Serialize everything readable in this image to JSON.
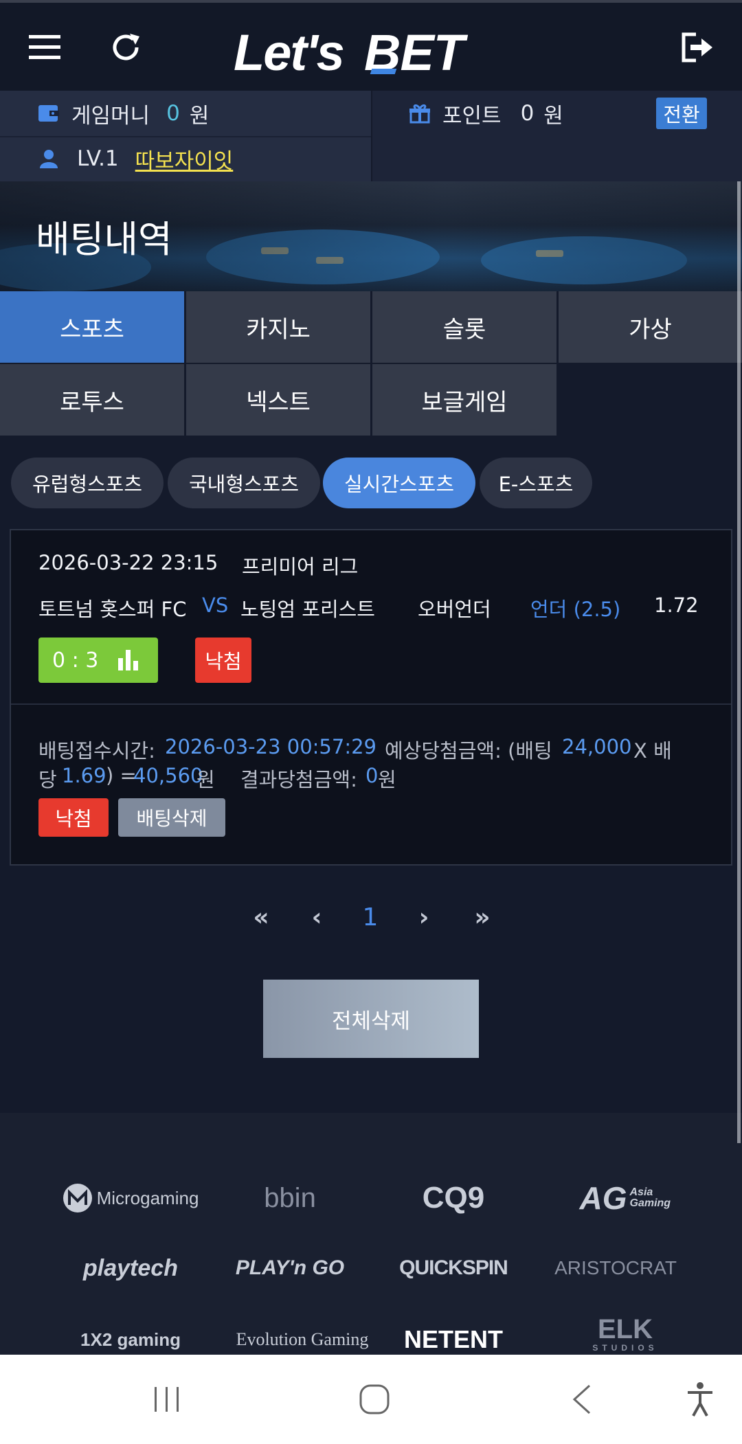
{
  "header": {
    "logo_part1": "Let's",
    "logo_part2": "BET",
    "menu_icon": "menu-icon",
    "refresh_icon": "refresh-icon",
    "logout_icon": "logout-icon"
  },
  "account": {
    "game_money_label": "게임머니",
    "game_money_value": "0",
    "game_money_unit": "원",
    "point_label": "포인트",
    "point_value": "0",
    "point_unit": "원",
    "convert_label": "전환",
    "level": "LV.1",
    "nickname": "따보자이잇"
  },
  "banner": {
    "title": "배팅내역"
  },
  "categories": [
    "스포츠",
    "카지노",
    "슬롯",
    "가상",
    "로투스",
    "넥스트",
    "보글게임"
  ],
  "active_category": "스포츠",
  "sport_tabs": [
    "유럽형스포츠",
    "국내형스포츠",
    "실시간스포츠",
    "E-스포츠"
  ],
  "active_sport_tab": "실시간스포츠",
  "bet": {
    "datetime": "2026-03-22 23:15",
    "league": "프리미어 리그",
    "home": "토트넘 홋스퍼 FC",
    "vs": "VS",
    "away": "노팅엄 포리스트",
    "market": "오버언더",
    "pick": "언더 (2.5)",
    "odds": "1.72",
    "score": "0 : 3",
    "result_label": "낙첨",
    "accept_time_label": "배팅접수시간:",
    "accept_time": "2026-03-23 00:57:29",
    "expected_label": "예상당첨금액: (배팅",
    "stake": "24,000",
    "times_label": "X 배",
    "odds_label_cont": "당",
    "total_odds": "1.69",
    "equals": ") =",
    "expected_win": "40,560",
    "won_unit": "원",
    "result_amount_label": "결과당첨금액:",
    "result_amount": "0",
    "result_unit": "원",
    "status_button": "낙첨",
    "delete_button": "배팅삭제"
  },
  "pagination": {
    "first": "«",
    "prev": "‹",
    "current": "1",
    "next": "›",
    "last": "»"
  },
  "delete_all": "전체삭제",
  "providers": [
    "Microgaming",
    "bbin",
    "CQ9",
    "AG",
    "playtech",
    "PLAY'n GO",
    "QUICKSPIN",
    "ARISTOCRAT",
    "1X2 gaming",
    "Evolution Gaming",
    "NETENT",
    "ELK"
  ],
  "providers_sub": {
    "ag": "Asia Gaming",
    "elk": "STUDIOS"
  }
}
